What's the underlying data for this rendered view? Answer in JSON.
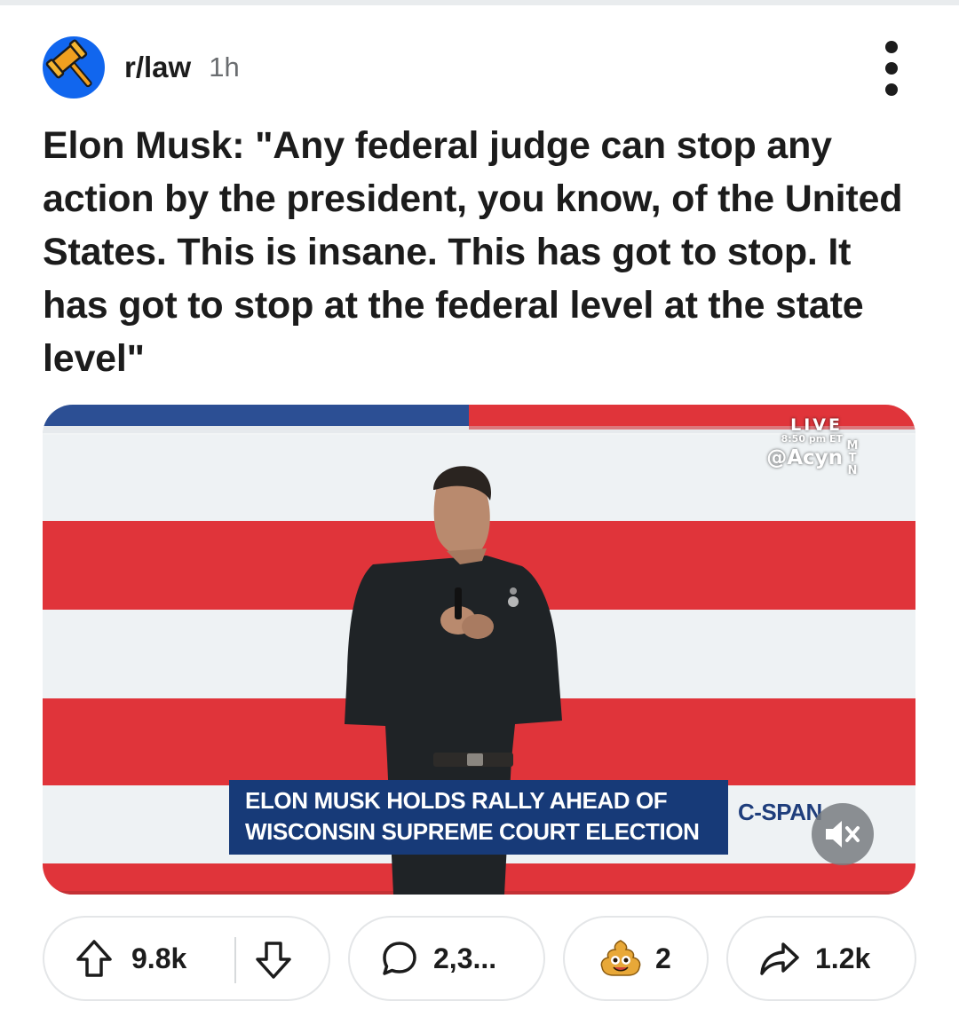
{
  "post": {
    "subreddit": "r/law",
    "age": "1h",
    "title": "Elon Musk: \"Any federal judge can stop any action by the president, you know, of the United States. This is insane. This has got to stop. It has got to stop at the federal level at the state level\"",
    "avatar_icon": "gavel-icon",
    "avatar_color": "#1166ee"
  },
  "media": {
    "watermark_live": "LIVE",
    "watermark_time": "8:50 pm ET",
    "watermark_handle": "@Acyn",
    "watermark_mtn": [
      "M",
      "T",
      "N"
    ],
    "chyron_line1": "ELON MUSK HOLDS RALLY AHEAD OF",
    "chyron_line2": "WISCONSIN SUPREME COURT ELECTION",
    "network_logo": "C-SPAN",
    "mute_icon": "speaker-muted-icon",
    "colors": {
      "flag_red": "#e0343a",
      "flag_white": "#eef2f4",
      "chyron_blue": "#173a78"
    }
  },
  "actions": {
    "upvote_count": "9.8k",
    "comment_count": "2,3...",
    "award_count": "2",
    "share_count": "1.2k",
    "icons": [
      "upvote-arrow-icon",
      "downvote-arrow-icon",
      "comment-bubble-icon",
      "award-icon",
      "share-arrow-icon"
    ]
  }
}
